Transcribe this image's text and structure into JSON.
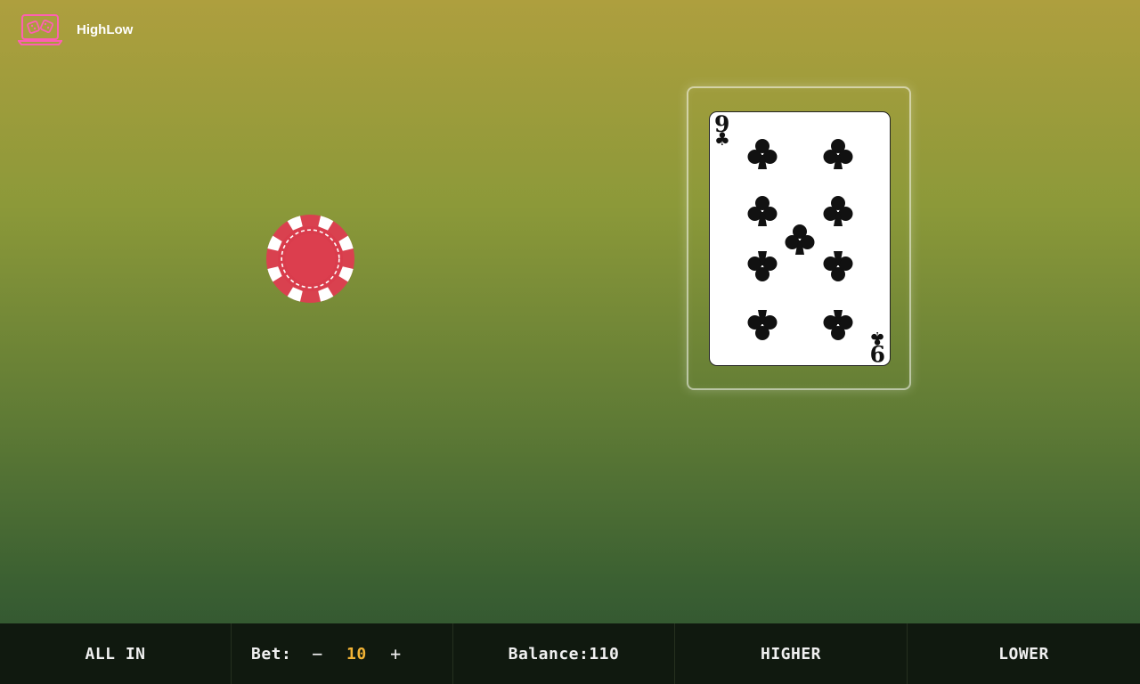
{
  "app": {
    "title": "HighLow",
    "logo_icon": "laptop-dice-icon"
  },
  "card": {
    "rank": "9",
    "suit": "clubs",
    "suit_symbol": "♣",
    "count": 9
  },
  "chip": {
    "icon": "poker-chip-icon",
    "color": "#d9414f"
  },
  "controls": {
    "all_in_label": "ALL IN",
    "bet_label": "Bet:",
    "bet_decrease": "−",
    "bet_value": "10",
    "bet_increase": "+",
    "balance_label": "Balance:110",
    "higher_label": "HIGHER",
    "lower_label": "LOWER"
  },
  "colors": {
    "accent": "#f2b335",
    "logo": "#ff5fb2",
    "bar": "#10190f"
  }
}
